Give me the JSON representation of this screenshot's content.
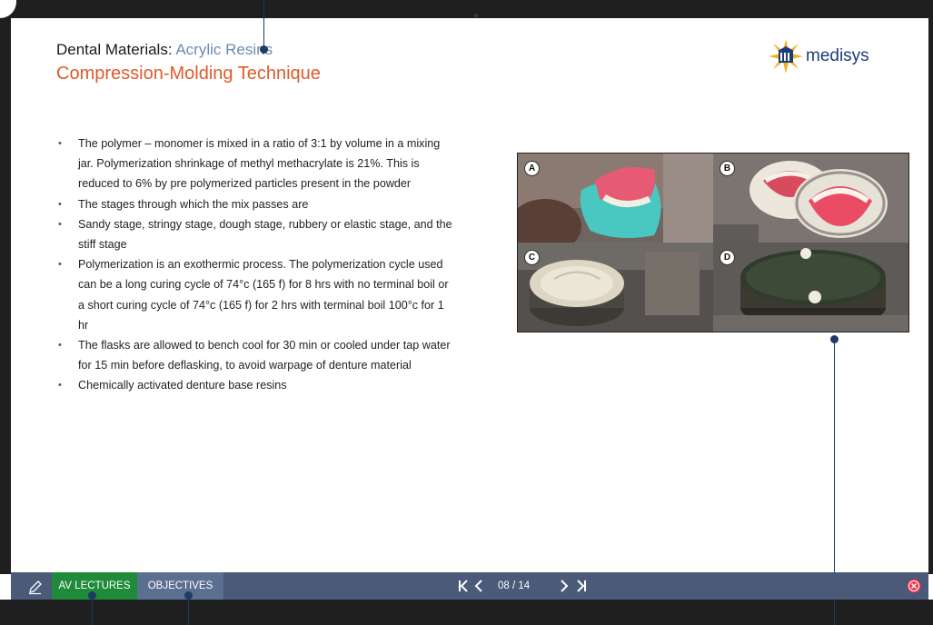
{
  "slide": {
    "title_prefix": "Dental Materials: ",
    "title_topic": "Acrylic Resins",
    "subtitle": "Compression-Molding Technique"
  },
  "logo": {
    "text": "medisys"
  },
  "bullets": [
    "The polymer – monomer is mixed in a ratio of 3:1 by volume in a mixing jar. Polymerization shrinkage of methyl methacrylate is 21%. This is reduced to 6% by pre polymerized particles present in the powder",
    "The stages through which the mix passes are",
    "Sandy stage, stringy stage, dough stage, rubbery or elastic stage, and the stiff stage",
    "Polymerization is an exothermic process. The polymerization cycle used can be a long curing cycle of 74°c (165 f) for 8 hrs with no terminal boil or a short curing cycle of 74°c (165 f) for 2 hrs with terminal boil 100°c for 1 hr",
    "The flasks are allowed to bench cool for 30 min or cooled under tap water for 15 min before deflasking, to avoid warpage of denture material",
    "Chemically activated denture base resins"
  ],
  "figure": {
    "panels": [
      {
        "label": "A"
      },
      {
        "label": "B"
      },
      {
        "label": "C"
      },
      {
        "label": "D"
      }
    ]
  },
  "toolbar": {
    "av_lectures": "AV LECTURES",
    "objectives": "OBJECTIVES",
    "page_counter": "08 / 14",
    "current_page": 8,
    "total_pages": 14
  },
  "colors": {
    "accent_green": "#1f8a3a",
    "toolbar_bg": "#4a5a78",
    "subtitle_orange": "#e05a2a",
    "topic_blue": "#6d8bb0",
    "close_red": "#e8344a"
  }
}
